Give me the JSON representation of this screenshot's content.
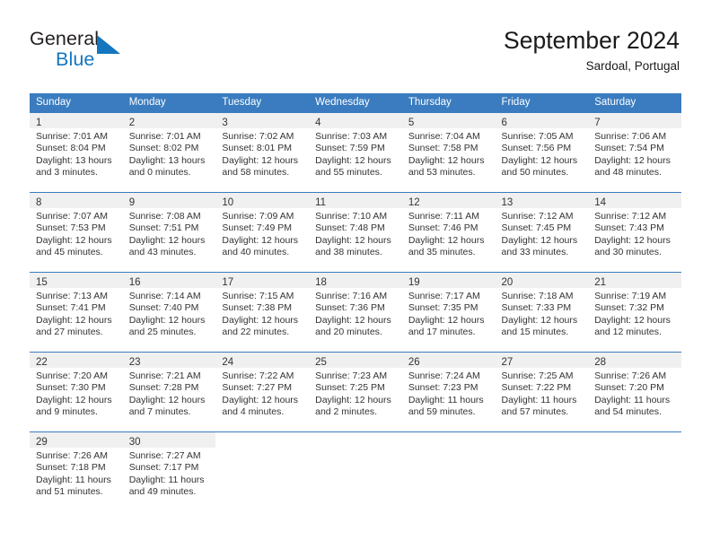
{
  "brand": {
    "name_part1": "General",
    "name_part2": "Blue",
    "logo_icon": "triangle-flag-icon"
  },
  "header": {
    "title": "September 2024",
    "subtitle": "Sardoal, Portugal"
  },
  "calendar": {
    "weekday_headers": [
      "Sunday",
      "Monday",
      "Tuesday",
      "Wednesday",
      "Thursday",
      "Friday",
      "Saturday"
    ],
    "accent_color": "#3a7cbf",
    "daynum_band_color": "#f0f0f0",
    "weeks": [
      [
        {
          "day": "1",
          "sunrise": "Sunrise: 7:01 AM",
          "sunset": "Sunset: 8:04 PM",
          "daylight1": "Daylight: 13 hours",
          "daylight2": "and 3 minutes."
        },
        {
          "day": "2",
          "sunrise": "Sunrise: 7:01 AM",
          "sunset": "Sunset: 8:02 PM",
          "daylight1": "Daylight: 13 hours",
          "daylight2": "and 0 minutes."
        },
        {
          "day": "3",
          "sunrise": "Sunrise: 7:02 AM",
          "sunset": "Sunset: 8:01 PM",
          "daylight1": "Daylight: 12 hours",
          "daylight2": "and 58 minutes."
        },
        {
          "day": "4",
          "sunrise": "Sunrise: 7:03 AM",
          "sunset": "Sunset: 7:59 PM",
          "daylight1": "Daylight: 12 hours",
          "daylight2": "and 55 minutes."
        },
        {
          "day": "5",
          "sunrise": "Sunrise: 7:04 AM",
          "sunset": "Sunset: 7:58 PM",
          "daylight1": "Daylight: 12 hours",
          "daylight2": "and 53 minutes."
        },
        {
          "day": "6",
          "sunrise": "Sunrise: 7:05 AM",
          "sunset": "Sunset: 7:56 PM",
          "daylight1": "Daylight: 12 hours",
          "daylight2": "and 50 minutes."
        },
        {
          "day": "7",
          "sunrise": "Sunrise: 7:06 AM",
          "sunset": "Sunset: 7:54 PM",
          "daylight1": "Daylight: 12 hours",
          "daylight2": "and 48 minutes."
        }
      ],
      [
        {
          "day": "8",
          "sunrise": "Sunrise: 7:07 AM",
          "sunset": "Sunset: 7:53 PM",
          "daylight1": "Daylight: 12 hours",
          "daylight2": "and 45 minutes."
        },
        {
          "day": "9",
          "sunrise": "Sunrise: 7:08 AM",
          "sunset": "Sunset: 7:51 PM",
          "daylight1": "Daylight: 12 hours",
          "daylight2": "and 43 minutes."
        },
        {
          "day": "10",
          "sunrise": "Sunrise: 7:09 AM",
          "sunset": "Sunset: 7:49 PM",
          "daylight1": "Daylight: 12 hours",
          "daylight2": "and 40 minutes."
        },
        {
          "day": "11",
          "sunrise": "Sunrise: 7:10 AM",
          "sunset": "Sunset: 7:48 PM",
          "daylight1": "Daylight: 12 hours",
          "daylight2": "and 38 minutes."
        },
        {
          "day": "12",
          "sunrise": "Sunrise: 7:11 AM",
          "sunset": "Sunset: 7:46 PM",
          "daylight1": "Daylight: 12 hours",
          "daylight2": "and 35 minutes."
        },
        {
          "day": "13",
          "sunrise": "Sunrise: 7:12 AM",
          "sunset": "Sunset: 7:45 PM",
          "daylight1": "Daylight: 12 hours",
          "daylight2": "and 33 minutes."
        },
        {
          "day": "14",
          "sunrise": "Sunrise: 7:12 AM",
          "sunset": "Sunset: 7:43 PM",
          "daylight1": "Daylight: 12 hours",
          "daylight2": "and 30 minutes."
        }
      ],
      [
        {
          "day": "15",
          "sunrise": "Sunrise: 7:13 AM",
          "sunset": "Sunset: 7:41 PM",
          "daylight1": "Daylight: 12 hours",
          "daylight2": "and 27 minutes."
        },
        {
          "day": "16",
          "sunrise": "Sunrise: 7:14 AM",
          "sunset": "Sunset: 7:40 PM",
          "daylight1": "Daylight: 12 hours",
          "daylight2": "and 25 minutes."
        },
        {
          "day": "17",
          "sunrise": "Sunrise: 7:15 AM",
          "sunset": "Sunset: 7:38 PM",
          "daylight1": "Daylight: 12 hours",
          "daylight2": "and 22 minutes."
        },
        {
          "day": "18",
          "sunrise": "Sunrise: 7:16 AM",
          "sunset": "Sunset: 7:36 PM",
          "daylight1": "Daylight: 12 hours",
          "daylight2": "and 20 minutes."
        },
        {
          "day": "19",
          "sunrise": "Sunrise: 7:17 AM",
          "sunset": "Sunset: 7:35 PM",
          "daylight1": "Daylight: 12 hours",
          "daylight2": "and 17 minutes."
        },
        {
          "day": "20",
          "sunrise": "Sunrise: 7:18 AM",
          "sunset": "Sunset: 7:33 PM",
          "daylight1": "Daylight: 12 hours",
          "daylight2": "and 15 minutes."
        },
        {
          "day": "21",
          "sunrise": "Sunrise: 7:19 AM",
          "sunset": "Sunset: 7:32 PM",
          "daylight1": "Daylight: 12 hours",
          "daylight2": "and 12 minutes."
        }
      ],
      [
        {
          "day": "22",
          "sunrise": "Sunrise: 7:20 AM",
          "sunset": "Sunset: 7:30 PM",
          "daylight1": "Daylight: 12 hours",
          "daylight2": "and 9 minutes."
        },
        {
          "day": "23",
          "sunrise": "Sunrise: 7:21 AM",
          "sunset": "Sunset: 7:28 PM",
          "daylight1": "Daylight: 12 hours",
          "daylight2": "and 7 minutes."
        },
        {
          "day": "24",
          "sunrise": "Sunrise: 7:22 AM",
          "sunset": "Sunset: 7:27 PM",
          "daylight1": "Daylight: 12 hours",
          "daylight2": "and 4 minutes."
        },
        {
          "day": "25",
          "sunrise": "Sunrise: 7:23 AM",
          "sunset": "Sunset: 7:25 PM",
          "daylight1": "Daylight: 12 hours",
          "daylight2": "and 2 minutes."
        },
        {
          "day": "26",
          "sunrise": "Sunrise: 7:24 AM",
          "sunset": "Sunset: 7:23 PM",
          "daylight1": "Daylight: 11 hours",
          "daylight2": "and 59 minutes."
        },
        {
          "day": "27",
          "sunrise": "Sunrise: 7:25 AM",
          "sunset": "Sunset: 7:22 PM",
          "daylight1": "Daylight: 11 hours",
          "daylight2": "and 57 minutes."
        },
        {
          "day": "28",
          "sunrise": "Sunrise: 7:26 AM",
          "sunset": "Sunset: 7:20 PM",
          "daylight1": "Daylight: 11 hours",
          "daylight2": "and 54 minutes."
        }
      ],
      [
        {
          "day": "29",
          "sunrise": "Sunrise: 7:26 AM",
          "sunset": "Sunset: 7:18 PM",
          "daylight1": "Daylight: 11 hours",
          "daylight2": "and 51 minutes."
        },
        {
          "day": "30",
          "sunrise": "Sunrise: 7:27 AM",
          "sunset": "Sunset: 7:17 PM",
          "daylight1": "Daylight: 11 hours",
          "daylight2": "and 49 minutes."
        },
        {
          "day": "",
          "sunrise": "",
          "sunset": "",
          "daylight1": "",
          "daylight2": ""
        },
        {
          "day": "",
          "sunrise": "",
          "sunset": "",
          "daylight1": "",
          "daylight2": ""
        },
        {
          "day": "",
          "sunrise": "",
          "sunset": "",
          "daylight1": "",
          "daylight2": ""
        },
        {
          "day": "",
          "sunrise": "",
          "sunset": "",
          "daylight1": "",
          "daylight2": ""
        },
        {
          "day": "",
          "sunrise": "",
          "sunset": "",
          "daylight1": "",
          "daylight2": ""
        }
      ]
    ]
  }
}
